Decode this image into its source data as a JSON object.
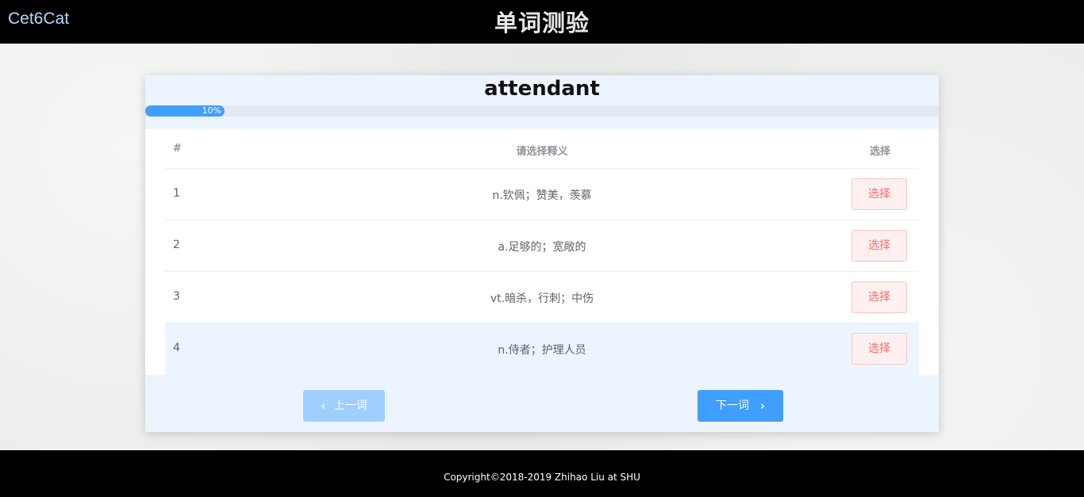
{
  "header": {
    "brand": "Cet6Cat",
    "title": "单词测验"
  },
  "quiz": {
    "word": "attendant",
    "progress": {
      "percent": 10,
      "label": "10%",
      "color": "#409eff"
    },
    "table": {
      "headers": {
        "index": "#",
        "definition": "请选择释义",
        "select": "选择"
      },
      "rows": [
        {
          "index": "1",
          "definition": "n.钦佩；赞美，羡慕",
          "button": "选择"
        },
        {
          "index": "2",
          "definition": "a.足够的；宽敞的",
          "button": "选择"
        },
        {
          "index": "3",
          "definition": "vt.暗杀，行刺；中伤",
          "button": "选择"
        },
        {
          "index": "4",
          "definition": "n.侍者；护理人员",
          "button": "选择"
        }
      ]
    },
    "nav": {
      "prev_label": "上一词",
      "prev_icon": "chevron-left-icon",
      "next_label": "下一词",
      "next_icon": "chevron-right-icon"
    }
  },
  "footer": {
    "copyright": "Copyright©2018-2019 Zhihao Liu at SHU"
  },
  "colors": {
    "accent": "#409eff",
    "accent_disabled": "#a0cfff",
    "danger": "#f56c6c",
    "danger_bg": "#fef0f0",
    "head_bg": "#ecf5ff"
  }
}
